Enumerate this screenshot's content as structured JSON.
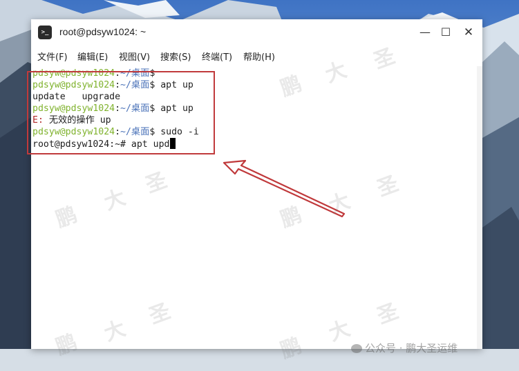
{
  "window": {
    "title": "root@pdsyw1024: ~",
    "icon": "terminal-icon",
    "controls": {
      "minimize": "—",
      "maximize": "☐",
      "close": "✕"
    }
  },
  "menubar": {
    "items": [
      "文件(F)",
      "编辑(E)",
      "视图(V)",
      "搜索(S)",
      "终端(T)",
      "帮助(H)"
    ]
  },
  "terminal": {
    "lines": [
      {
        "user": "pdsyw@pdsyw1024",
        "sep": ":",
        "path": "~/桌面",
        "rest": "$"
      },
      {
        "user": "pdsyw@pdsyw1024",
        "sep": ":",
        "path": "~/桌面",
        "rest": "$ apt up"
      },
      {
        "text": "update   upgrade"
      },
      {
        "user": "pdsyw@pdsyw1024",
        "sep": ":",
        "path": "~/桌面",
        "rest": "$ apt up"
      },
      {
        "err": "E:",
        "text": " 无效的操作 up"
      },
      {
        "user": "pdsyw@pdsyw1024",
        "sep": ":",
        "path": "~/桌面",
        "rest": "$ sudo -i"
      },
      {
        "text": "root@pdsyw1024:~# apt upd"
      }
    ]
  },
  "watermark": {
    "chars": [
      "鹏",
      "大",
      "圣"
    ],
    "footer": "公众号 · 鹏大圣运维"
  },
  "colors": {
    "prompt_user": "#7fb22c",
    "prompt_path": "#4a72b8",
    "error": "#b02a2a",
    "highlight": "#c0393b"
  }
}
